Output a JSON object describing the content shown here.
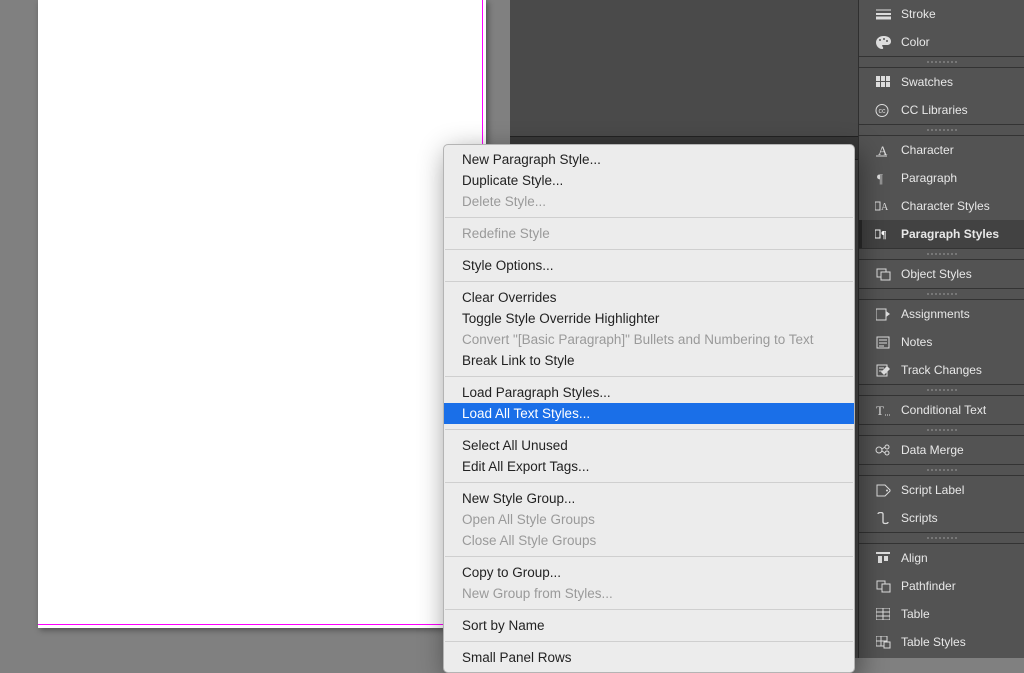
{
  "panels": {
    "stroke": "Stroke",
    "color": "Color",
    "swatches": "Swatches",
    "cc_libraries": "CC Libraries",
    "character": "Character",
    "paragraph": "Paragraph",
    "character_styles": "Character Styles",
    "paragraph_styles": "Paragraph Styles",
    "object_styles": "Object Styles",
    "assignments": "Assignments",
    "notes": "Notes",
    "track_changes": "Track Changes",
    "conditional_text": "Conditional Text",
    "data_merge": "Data Merge",
    "script_label": "Script Label",
    "scripts": "Scripts",
    "align": "Align",
    "pathfinder": "Pathfinder",
    "table": "Table",
    "table_styles": "Table Styles"
  },
  "active_panel": "paragraph_styles",
  "context_menu": {
    "new_paragraph_style": "New Paragraph Style...",
    "duplicate_style": "Duplicate Style...",
    "delete_style": "Delete Style...",
    "redefine_style": "Redefine Style",
    "style_options": "Style Options...",
    "clear_overrides": "Clear Overrides",
    "toggle_override_highlighter": "Toggle Style Override Highlighter",
    "convert_bullets": "Convert \"[Basic Paragraph]\" Bullets and Numbering to Text",
    "break_link": "Break Link to Style",
    "load_paragraph_styles": "Load Paragraph Styles...",
    "load_all_text_styles": "Load All Text Styles...",
    "select_all_unused": "Select All Unused",
    "edit_all_export_tags": "Edit All Export Tags...",
    "new_style_group": "New Style Group...",
    "open_all_groups": "Open All Style Groups",
    "close_all_groups": "Close All Style Groups",
    "copy_to_group": "Copy to Group...",
    "new_group_from_styles": "New Group from Styles...",
    "sort_by_name": "Sort by Name",
    "small_panel_rows": "Small Panel Rows"
  },
  "highlighted_menu_item": "load_all_text_styles"
}
